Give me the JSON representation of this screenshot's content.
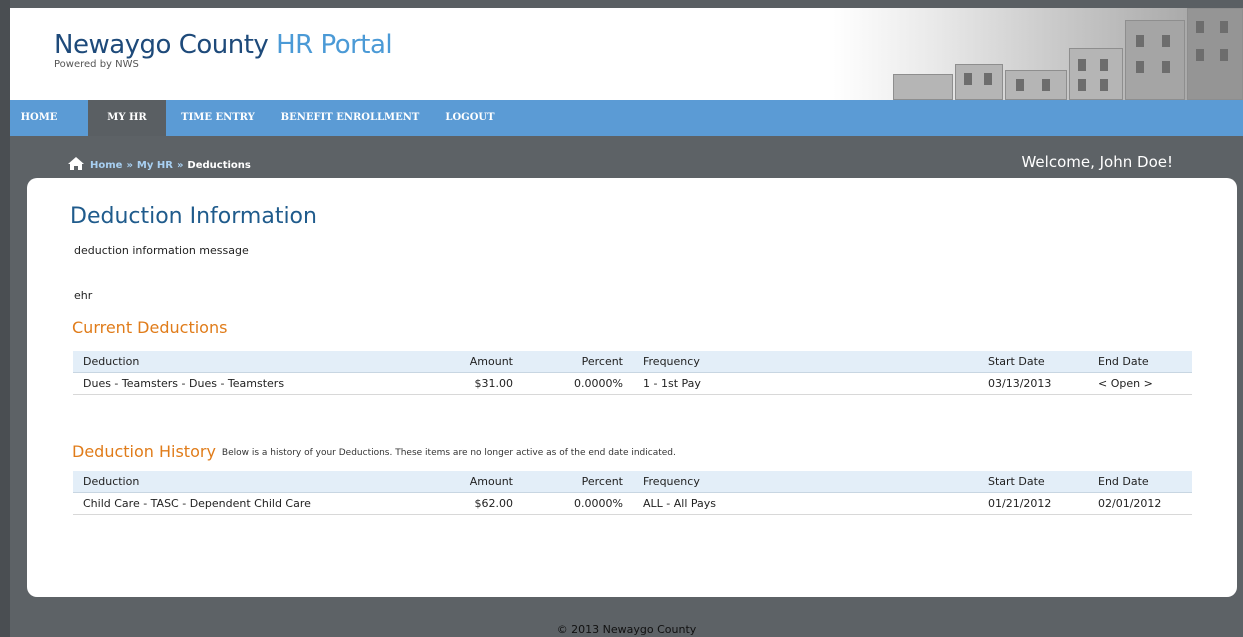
{
  "brand": {
    "title_main": "Newaygo County",
    "title_accent": "HR Portal",
    "subtitle": "Powered by NWS"
  },
  "nav": {
    "items": [
      {
        "label": "HOME",
        "active": false
      },
      {
        "label": "MY HR",
        "active": true
      },
      {
        "label": "TIME ENTRY",
        "active": false
      },
      {
        "label": "BENEFIT ENROLLMENT",
        "active": false
      },
      {
        "label": "LOGOUT",
        "active": false
      }
    ]
  },
  "breadcrumb": {
    "icon": "home-icon",
    "items": [
      "Home",
      "My HR",
      "Deductions"
    ],
    "separator": "»"
  },
  "welcome": "Welcome, John Doe!",
  "content": {
    "title": "Deduction Information",
    "message": "deduction information message",
    "note": "ehr"
  },
  "current": {
    "title": "Current Deductions",
    "columns": [
      "Deduction",
      "Amount",
      "Percent",
      "Frequency",
      "Start Date",
      "End Date"
    ],
    "rows": [
      [
        "Dues - Teamsters - Dues - Teamsters",
        "$31.00",
        "0.0000%",
        "1 - 1st Pay",
        "03/13/2013",
        "< Open >"
      ]
    ]
  },
  "history": {
    "title": "Deduction History",
    "description": "Below is a history of your Deductions. These items are no longer active as of the end date indicated.",
    "columns": [
      "Deduction",
      "Amount",
      "Percent",
      "Frequency",
      "Start Date",
      "End Date"
    ],
    "rows": [
      [
        "Child Care - TASC - Dependent Child Care",
        "$62.00",
        "0.0000%",
        "ALL - All Pays",
        "01/21/2012",
        "02/01/2012"
      ]
    ]
  },
  "footer": "© 2013 Newaygo County",
  "colors": {
    "header_title": "#1e4a7a",
    "header_accent": "#4b9ad6",
    "nav_bar": "#5b9bd5",
    "nav_active": "#5a5f63",
    "section_title": "#e07c1a",
    "page_bg": "#5d6266"
  }
}
